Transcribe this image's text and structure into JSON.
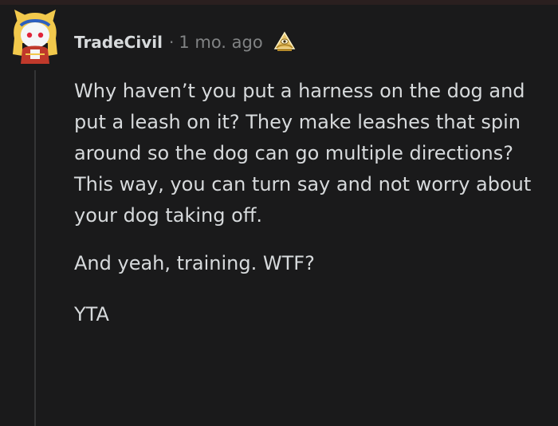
{
  "comment": {
    "author": "TradeCivil",
    "separator": "·",
    "timestamp": "1 mo. ago",
    "award": "mod-award-icon",
    "paragraphs": [
      "Why haven’t you put a harness on the dog and put a leash on it? They make leashes that spin around so the dog can go multiple directions? This way, you can turn say and not worry about your dog taking off.",
      "And yeah, training. WTF?",
      "YTA"
    ]
  },
  "colors": {
    "background": "#1a1a1b",
    "text": "#d7dadc",
    "muted": "#818384",
    "thread_line": "#343536",
    "award_gold": "#e8c46a"
  }
}
